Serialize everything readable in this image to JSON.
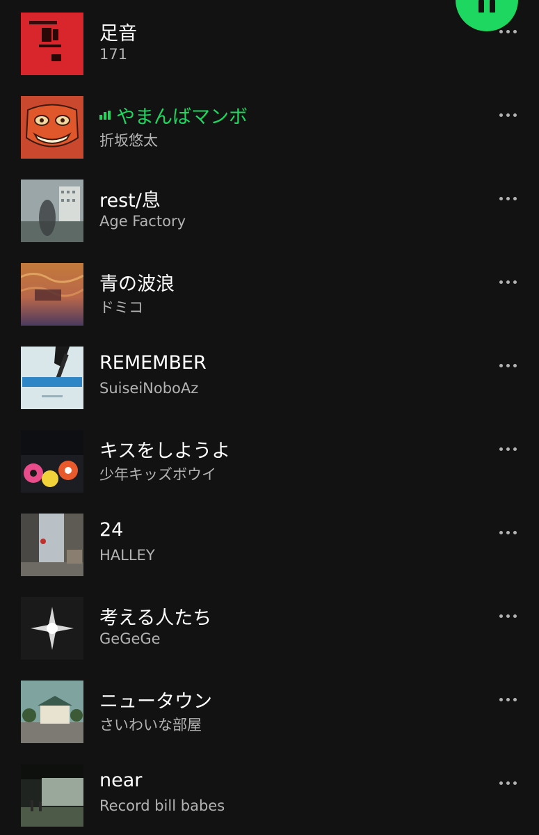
{
  "player": {
    "state": "playing",
    "accent_color": "#1ed760",
    "control_icon": "pause-icon"
  },
  "tracks": [
    {
      "title": "足音",
      "artist": "171",
      "playing": false,
      "cover_icon": "album-art"
    },
    {
      "title": "やまんばマンボ",
      "artist": "折坂悠太",
      "playing": true,
      "cover_icon": "album-art"
    },
    {
      "title": "rest/息",
      "artist": "Age Factory",
      "playing": false,
      "cover_icon": "album-art"
    },
    {
      "title": "青の波浪",
      "artist": "ドミコ",
      "playing": false,
      "cover_icon": "album-art"
    },
    {
      "title": "REMEMBER",
      "artist": "SuiseiNoboAz",
      "playing": false,
      "cover_icon": "album-art"
    },
    {
      "title": "キスをしようよ",
      "artist": "少年キッズボウイ",
      "playing": false,
      "cover_icon": "album-art"
    },
    {
      "title": "24",
      "artist": "HALLEY",
      "playing": false,
      "cover_icon": "album-art"
    },
    {
      "title": "考える人たち",
      "artist": "GeGeGe",
      "playing": false,
      "cover_icon": "album-art"
    },
    {
      "title": "ニュータウン",
      "artist": "さいわいな部屋",
      "playing": false,
      "cover_icon": "album-art"
    },
    {
      "title": "near",
      "artist": "Record bill babes",
      "playing": false,
      "cover_icon": "album-art"
    }
  ]
}
